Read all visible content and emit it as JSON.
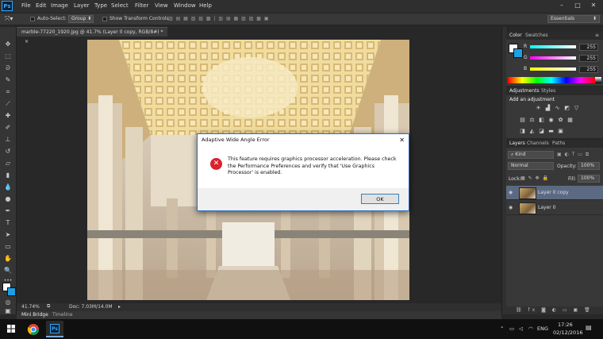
{
  "app": {
    "logo": "Ps",
    "accent": "#31a8ff"
  },
  "menu": [
    "File",
    "Edit",
    "Image",
    "Layer",
    "Type",
    "Select",
    "Filter",
    "View",
    "Window",
    "Help"
  ],
  "window_controls": [
    "minimize-icon",
    "maximize-icon",
    "close-icon"
  ],
  "options_bar": {
    "auto_select_label": "Auto-Select:",
    "group_select": "Group",
    "show_transform_label": "Show Transform Controls",
    "workspace": "Essentials"
  },
  "document": {
    "tab_title": "marble-77220_1920.jpg @ 41.7% (Layer 0 copy, RGB/8#) *",
    "tab_close": "×"
  },
  "status": {
    "zoom": "41.74%",
    "doc_info": "Doc: 7.03M/14.0M"
  },
  "bottom_tabs": [
    "Mini Bridge",
    "Timeline"
  ],
  "color_panel": {
    "tabs": [
      "Color",
      "Swatches"
    ],
    "channels": [
      {
        "label": "R",
        "value": "255"
      },
      {
        "label": "G",
        "value": "255"
      },
      {
        "label": "B",
        "value": "255"
      }
    ]
  },
  "adjustments_panel": {
    "tabs": [
      "Adjustments",
      "Styles"
    ],
    "heading": "Add an adjustment"
  },
  "layers_panel": {
    "tabs": [
      "Layers",
      "Channels",
      "Paths"
    ],
    "kind_label": "Kind",
    "blend_mode": "Normal",
    "opacity_label": "Opacity:",
    "opacity_value": "100%",
    "lock_label": "Lock:",
    "fill_label": "Fill:",
    "fill_value": "100%",
    "layers": [
      {
        "name": "Layer 0 copy",
        "selected": true
      },
      {
        "name": "Layer 0",
        "selected": false
      }
    ]
  },
  "dialog": {
    "title": "Adaptive Wide Angle Error",
    "close": "✕",
    "message": "This feature requires graphics processor acceleration. Please check the Performance Preferences and verify that 'Use Graphics Processor' is enabled.",
    "ok_label": "OK"
  },
  "taskbar": {
    "language": "ENG",
    "time": "17:26",
    "date": "02/12/2016"
  }
}
